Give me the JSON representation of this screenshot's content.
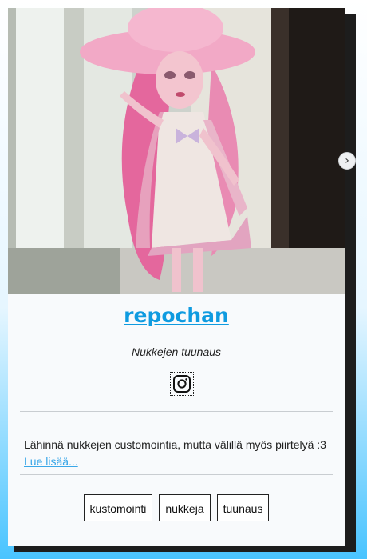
{
  "profile": {
    "name": "repochan",
    "tagline": "Nukkejen tuunaus",
    "description": "Lähinnä nukkejen customointia, mutta välillä myös piirtelyä :3",
    "read_more": "Lue lisää...",
    "social_icon": "instagram-icon",
    "photo": "pink-haired-doll-with-hat-photo"
  },
  "tags": [
    "kustomointi",
    "nukkeja",
    "tuunaus"
  ],
  "navigation": {
    "next_arrow": "›"
  },
  "colors": {
    "accent": "#0f9be0",
    "link": "#3aa7e8",
    "background_gradient_bottom": "#49c4ff",
    "card": "#f8fafc"
  }
}
